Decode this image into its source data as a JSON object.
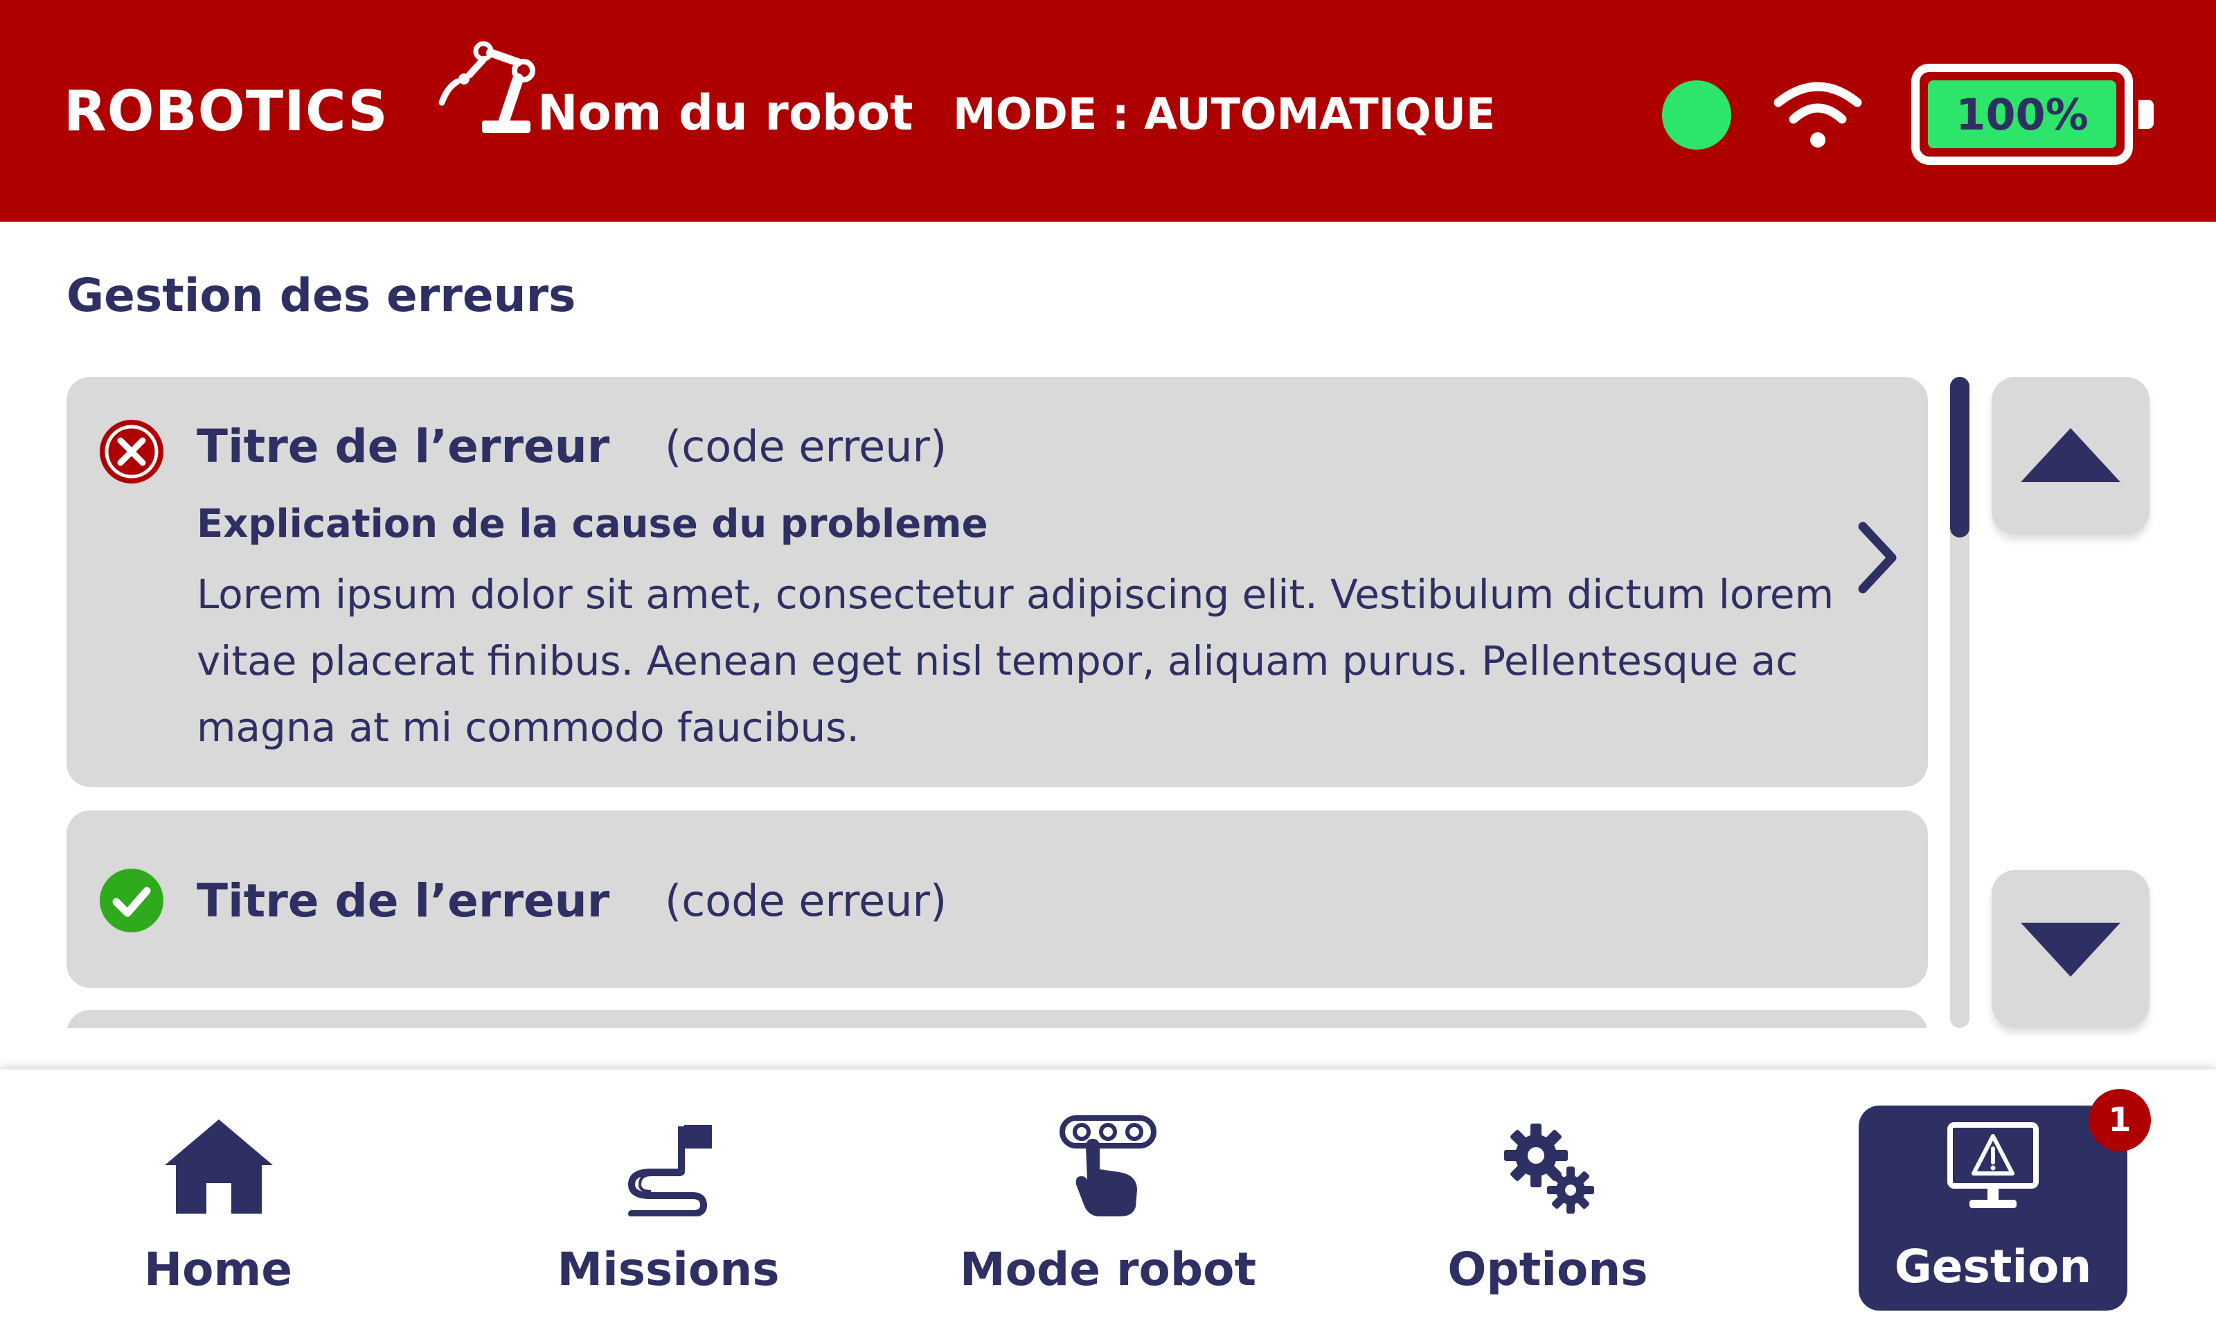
{
  "header": {
    "logo_text": "ROBOTICS",
    "robot_name": "Nom du robot",
    "mode_label": "MODE : AUTOMATIQUE",
    "status_color": "#2ee56b",
    "wifi_icon": "wifi-icon",
    "battery_level": "100%",
    "battery_fraction": 1.0
  },
  "colors": {
    "header_bg": "#ae0000",
    "text_primary": "#2e2f63",
    "card_bg": "#d9d9d9",
    "error_red": "#ae0000",
    "success_green": "#2faa1c",
    "status_green": "#2ee56b"
  },
  "page": {
    "title": "Gestion des erreurs"
  },
  "errors": [
    {
      "status": "error",
      "icon": "error-x-icon",
      "title": "Titre de l’erreur",
      "code": "(code erreur)",
      "subtitle": "Explication de la cause du probleme",
      "description": "Lorem ipsum dolor sit amet, consectetur adipiscing elit. Vestibulum dictum lorem vitae placerat finibus. Aenean eget nisl tempor, aliquam purus. Pellentesque ac magna at mi commodo faucibus.",
      "expanded": true
    },
    {
      "status": "resolved",
      "icon": "check-icon",
      "title": "Titre de l’erreur",
      "code": "(code erreur)",
      "expanded": false
    }
  ],
  "scroll": {
    "up_icon": "triangle-up-icon",
    "down_icon": "triangle-down-icon"
  },
  "nav": {
    "items": [
      {
        "label": "Home",
        "icon": "home-icon",
        "active": false
      },
      {
        "label": "Missions",
        "icon": "missions-flag-icon",
        "active": false
      },
      {
        "label": "Mode robot",
        "icon": "mode-robot-hand-icon",
        "active": false
      },
      {
        "label": "Options",
        "icon": "gears-icon",
        "active": false
      },
      {
        "label": "Gestion",
        "icon": "monitor-warning-icon",
        "active": true
      }
    ],
    "gestion_badge": "1"
  }
}
